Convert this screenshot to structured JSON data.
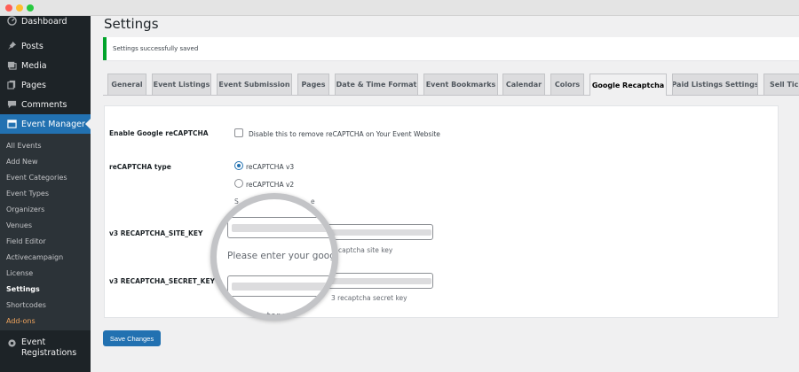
{
  "window": {
    "controls": [
      "close",
      "minimize",
      "maximize"
    ]
  },
  "sidebar": {
    "top_items": [
      {
        "label": "Dashboard",
        "icon": "dashboard-icon"
      },
      {
        "label": "Posts",
        "icon": "pin-icon"
      },
      {
        "label": "Media",
        "icon": "media-icon"
      },
      {
        "label": "Pages",
        "icon": "pages-icon"
      },
      {
        "label": "Comments",
        "icon": "comment-icon"
      },
      {
        "label": "Event Manager",
        "icon": "calendar-icon",
        "active": true
      }
    ],
    "submenu": [
      "All Events",
      "Add New",
      "Event Categories",
      "Event Types",
      "Organizers",
      "Venues",
      "Field Editor",
      "Activecampaign",
      "License",
      "Settings",
      "Shortcodes",
      "Add-ons"
    ],
    "current_sub": "Settings",
    "bottom_item": {
      "label_line1": "Event",
      "label_line2": "Registrations",
      "icon": "gear-icon"
    }
  },
  "page": {
    "title": "Settings",
    "notice": "Settings successfully saved"
  },
  "tabs": [
    "General",
    "Event Listings",
    "Event Submission",
    "Pages",
    "Date & Time Format",
    "Event Bookmarks",
    "Calendar",
    "Colors",
    "Google Recaptcha",
    "Paid Listings Settings",
    "Sell Tick"
  ],
  "active_tab": "Google Recaptcha",
  "form": {
    "enable_label": "Enable Google reCAPTCHA",
    "enable_checkbox_label": "Disable this to remove reCAPTCHA on Your Event Website",
    "enable_checked": false,
    "type_label": "reCAPTCHA type",
    "type_options": [
      "reCAPTCHA v3",
      "reCAPTCHA v2"
    ],
    "type_selected": "reCAPTCHA v3",
    "type_hint_fragment": "S",
    "type_hint_tail": "e",
    "site_key_label": "v3 RECAPTCHA_SITE_KEY",
    "site_key_hint_tail": "captcha site key",
    "secret_key_label": "v3 RECAPTCHA_SECRET_KEY",
    "secret_key_hint_tail": "3 recaptcha secret key",
    "save_label": "Save Changes"
  },
  "magnifier": {
    "site_hint": "Please enter your google",
    "secret_hint": "se enter your",
    "selected_fragment": "S"
  },
  "colors": {
    "accent": "#2271b1",
    "sidebar_bg": "#1d2327",
    "notice_border": "#00a32a",
    "addons": "#f0a45d"
  }
}
